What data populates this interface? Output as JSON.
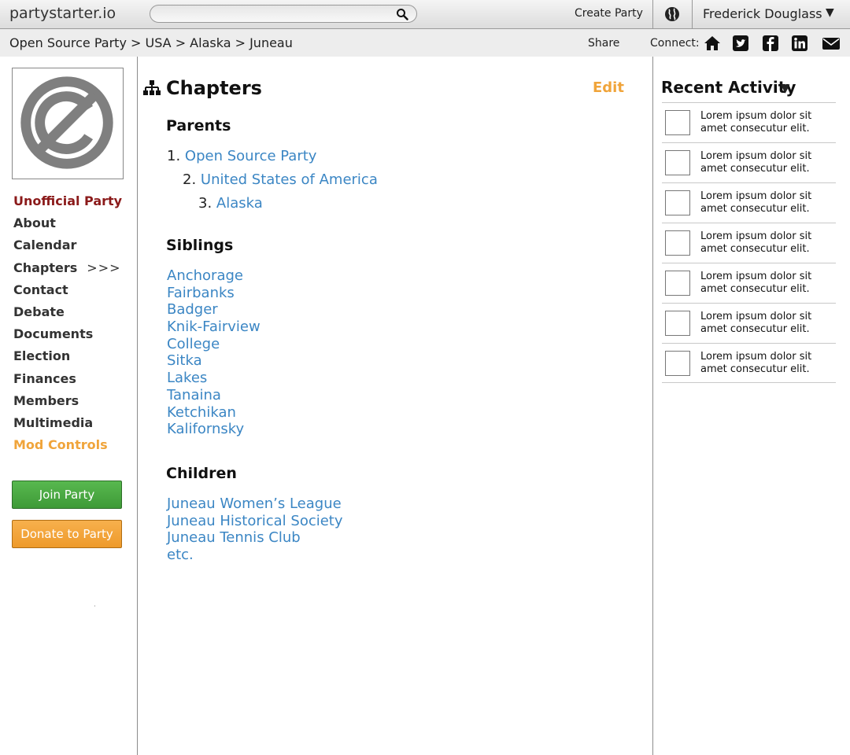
{
  "topbar": {
    "logo": "partystarter.io",
    "search_placeholder": "",
    "create_party": "Create Party",
    "user_name": "Frederick Douglass",
    "user_caret": "▼"
  },
  "breadcrumb": {
    "text": "Open Source Party > USA > Alaska > Juneau",
    "share": "Share",
    "connect": "Connect:",
    "social_icons": [
      "home-icon",
      "twitter-icon",
      "facebook-icon",
      "linkedin-icon",
      "email-icon"
    ]
  },
  "sidebar": {
    "items": [
      {
        "label": "Unofficial Party"
      },
      {
        "label": "About"
      },
      {
        "label": "Calendar"
      },
      {
        "label": "Chapters",
        "suffix": ">>>"
      },
      {
        "label": "Contact"
      },
      {
        "label": "Debate"
      },
      {
        "label": "Documents"
      },
      {
        "label": "Election"
      },
      {
        "label": "Finances"
      },
      {
        "label": "Members"
      },
      {
        "label": "Multimedia"
      },
      {
        "label": "Mod Controls"
      }
    ],
    "join_button": "Join Party",
    "donate_button": "Donate to Party"
  },
  "main": {
    "title": "Chapters",
    "edit": "Edit",
    "parents_heading": "Parents",
    "parents": [
      {
        "num": "1.",
        "label": "Open Source Party"
      },
      {
        "num": "2.",
        "label": "United States of America"
      },
      {
        "num": "3.",
        "label": "Alaska"
      }
    ],
    "siblings_heading": "Siblings",
    "siblings": [
      "Anchorage",
      "Fairbanks",
      "Badger",
      "Knik-Fairview",
      "College",
      "Sitka",
      "Lakes",
      "Tanaina",
      "Ketchikan",
      "Kalifornsky"
    ],
    "children_heading": "Children",
    "children": [
      "Juneau Women’s League",
      "Juneau Historical Society",
      "Juneau Tennis Club",
      "etc."
    ]
  },
  "recent_activity": {
    "title": "Recent Activity",
    "caret": "▼",
    "items": [
      "Lorem ipsum dolor sit amet consecutur elit.",
      "Lorem ipsum dolor sit amet consecutur elit.",
      "Lorem ipsum dolor sit amet consecutur elit.",
      "Lorem ipsum dolor sit amet consecutur elit.",
      "Lorem ipsum dolor sit amet consecutur elit.",
      "Lorem ipsum dolor sit amet consecutur elit.",
      "Lorem ipsum dolor sit amet consecutur elit."
    ]
  },
  "colors": {
    "link": "#3b86c4",
    "accent_orange": "#f0a43a",
    "party_red": "#8b1a1a",
    "join_green": "#4caf45"
  }
}
